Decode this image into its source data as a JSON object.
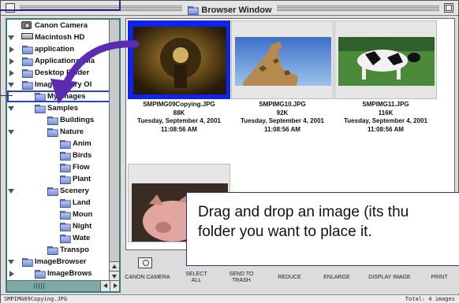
{
  "window": {
    "title": "Browser Window"
  },
  "tree": {
    "items": [
      {
        "label": "Canon Camera",
        "icon": "camera-icon",
        "disclosure": "none",
        "indent": 0
      },
      {
        "label": "Macintosh HD",
        "icon": "hard-drive-icon",
        "disclosure": "down",
        "indent": 0
      },
      {
        "label": "application",
        "icon": "folder-icon",
        "disclosure": "right",
        "indent": 1
      },
      {
        "label": "Applications (Ma",
        "icon": "folder-icon",
        "disclosure": "right",
        "indent": 1
      },
      {
        "label": "Desktop Folder",
        "icon": "folder-icon",
        "disclosure": "right",
        "indent": 1
      },
      {
        "label": "ImageLibrary Ol",
        "icon": "folder-icon",
        "disclosure": "down",
        "indent": 1
      },
      {
        "label": "My Images",
        "icon": "folder-icon",
        "disclosure": "none",
        "indent": 2,
        "selected": true
      },
      {
        "label": "Samples",
        "icon": "folder-icon",
        "disclosure": "down",
        "indent": 2
      },
      {
        "label": "Buildings",
        "icon": "folder-icon",
        "disclosure": "none",
        "indent": 3
      },
      {
        "label": "Nature",
        "icon": "folder-icon",
        "disclosure": "down",
        "indent": 3
      },
      {
        "label": "Anim",
        "icon": "folder-icon",
        "disclosure": "none",
        "indent": 4
      },
      {
        "label": "Birds",
        "icon": "folder-icon",
        "disclosure": "none",
        "indent": 4
      },
      {
        "label": "Flow",
        "icon": "folder-icon",
        "disclosure": "none",
        "indent": 4
      },
      {
        "label": "Plant",
        "icon": "folder-icon",
        "disclosure": "none",
        "indent": 4
      },
      {
        "label": "Scenery",
        "icon": "folder-icon",
        "disclosure": "down",
        "indent": 3
      },
      {
        "label": "Land",
        "icon": "folder-icon",
        "disclosure": "none",
        "indent": 4
      },
      {
        "label": "Moun",
        "icon": "folder-icon",
        "disclosure": "none",
        "indent": 4
      },
      {
        "label": "Night",
        "icon": "folder-icon",
        "disclosure": "none",
        "indent": 4
      },
      {
        "label": "Wate",
        "icon": "folder-icon",
        "disclosure": "none",
        "indent": 4
      },
      {
        "label": "Transpo",
        "icon": "folder-icon",
        "disclosure": "none",
        "indent": 3
      },
      {
        "label": "ImageBrowser",
        "icon": "folder-icon",
        "disclosure": "down",
        "indent": 1
      },
      {
        "label": "ImageBrows",
        "icon": "folder-icon",
        "disclosure": "right",
        "indent": 2
      }
    ]
  },
  "thumbnails": [
    {
      "filename": "SMPIMG09Copying.JPG",
      "size": "88K",
      "date": "Tuesday, September 4, 2001",
      "time": "11:08:56 AM",
      "selected": true
    },
    {
      "filename": "SMPIMG10.JPG",
      "size": "92K",
      "date": "Tuesday, September 4, 2001",
      "time": "11:08:56 AM",
      "selected": false
    },
    {
      "filename": "SMPIMG11.JPG",
      "size": "116K",
      "date": "Tuesday, September 4, 2001",
      "time": "11:08:56 AM",
      "selected": false
    },
    {
      "filename": "",
      "size": "",
      "date": "",
      "time": "",
      "selected": false
    }
  ],
  "toolbar": {
    "canon_camera": "CANON CAMERA",
    "select_all_1": "SELECT",
    "select_all_2": "ALL",
    "send_to_trash_1": "SEND TO",
    "send_to_trash_2": "TRASH",
    "reduce": "REDUCE",
    "enlarge": "ENLARGE",
    "display_image": "DISPLAY IMAGE",
    "print": "PRINT"
  },
  "status": {
    "left": "SMPIMG09Copying.JPG",
    "right": "Total: 4 images"
  },
  "tooltip": {
    "text": "Drag and drop an image (its thu\nfolder you want to place it."
  },
  "colors": {
    "selection": "#0f24e8",
    "tree_frame": "#3c7a78",
    "tooltip_border": "#3b2a8a",
    "arrow": "#5b2bb0"
  }
}
